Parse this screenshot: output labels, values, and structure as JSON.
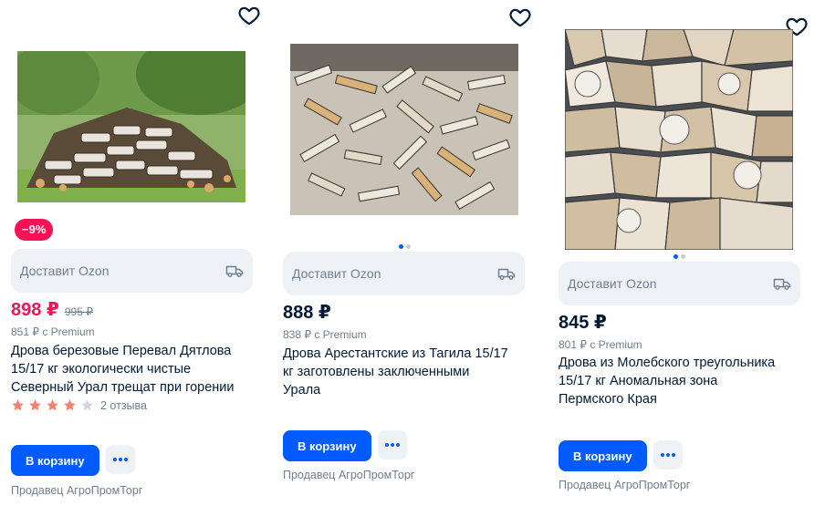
{
  "products": [
    {
      "discount": "−9%",
      "delivery": "Доставит Ozon",
      "price": "898 ₽",
      "old_price": "995 ₽",
      "premium_price": "851 ₽ с Premium",
      "title_lines": [
        "Дрова березовые Перевал Дятлова",
        "15/17 кг экологически чистые",
        "Северный Урал трещат при горении"
      ],
      "rating": 4,
      "reviews": "2 отзыва",
      "cart_label": "В корзину",
      "seller": "Продавец АгроПромТорг"
    },
    {
      "delivery": "Доставит Ozon",
      "price": "888 ₽",
      "premium_price": "838 ₽ с Premium",
      "title_lines": [
        "Дрова Арестантские из Тагила 15/17",
        "кг заготовлены заключенными",
        "Урала"
      ],
      "cart_label": "В корзину",
      "seller": "Продавец АгроПромТорг"
    },
    {
      "delivery": "Доставит Ozon",
      "price": "845 ₽",
      "premium_price": "801 ₽ с Premium",
      "title_lines": [
        "Дрова из Молебского треугольника",
        "15/17 кг Аномальная зона",
        "Пермского Края"
      ],
      "cart_label": "В корзину",
      "seller": "Продавец АгроПромТорг"
    }
  ],
  "icons": {
    "favorite": "heart-icon",
    "delivery": "truck-icon",
    "more": "more-dots-icon",
    "star": "star-icon"
  },
  "colors": {
    "accent": "#005bff",
    "sale": "#f91155",
    "star": "#f6826e",
    "muted": "#707f8d"
  }
}
